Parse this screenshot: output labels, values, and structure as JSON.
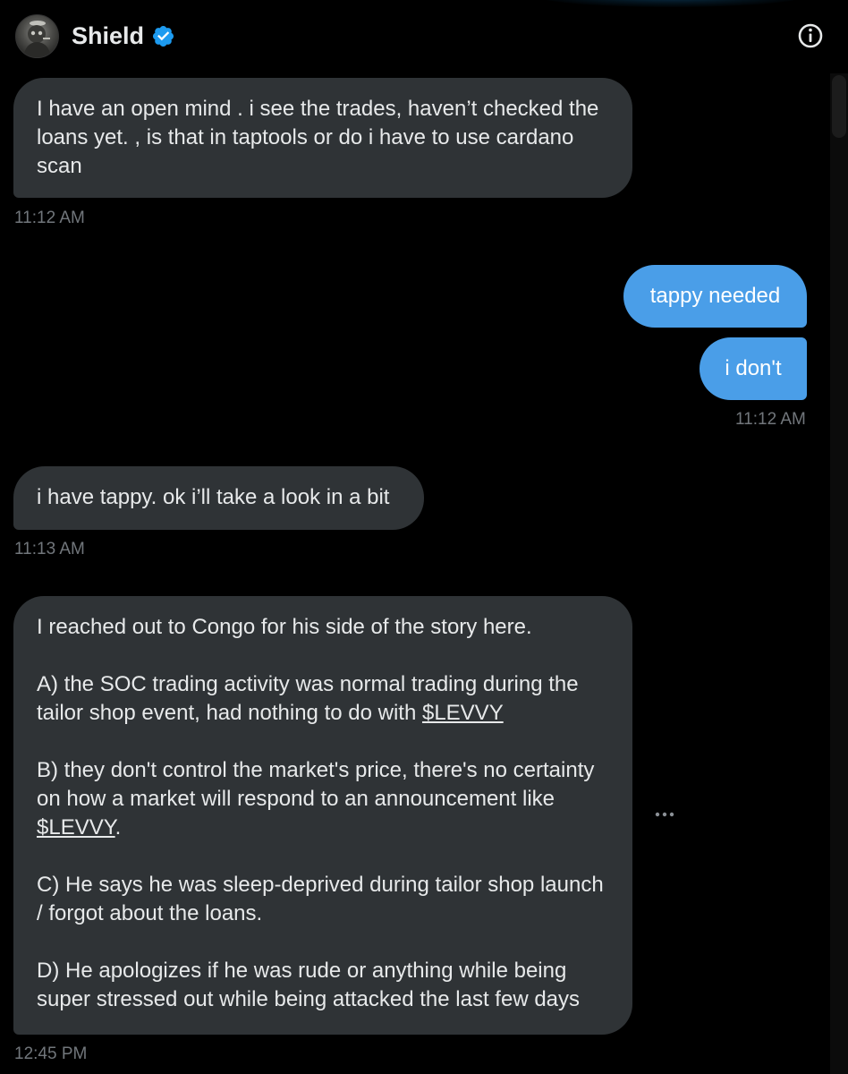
{
  "header": {
    "display_name": "Shield",
    "verified_icon": "verified-badge-icon",
    "info_icon": "info-icon"
  },
  "colors": {
    "background": "#000000",
    "incoming_bubble": "#2f3336",
    "outgoing_bubble": "#4a9ee8",
    "timestamp": "#71767b",
    "verified": "#1d9bf0"
  },
  "messages": [
    {
      "direction": "incoming",
      "text": "I have an open mind . i see the trades, haven’t checked the loans yet. , is that in taptools or do i have to use cardano scan",
      "time": "11:12 AM"
    },
    {
      "direction": "outgoing",
      "text": "tappy needed"
    },
    {
      "direction": "outgoing",
      "text": "i don't",
      "time": "11:12 AM"
    },
    {
      "direction": "incoming",
      "text": "i have tappy. ok i’ll take a look in a bit",
      "time": "11:13 AM"
    },
    {
      "direction": "incoming",
      "paragraphs": {
        "p1": "I reached out to Congo for his side of the story here.",
        "p2_text": "A) the SOC trading activity was normal trading during the tailor shop event, had nothing to do with ",
        "p2_tag": "$LEVVY",
        "p3_text": "B) they don't control the market's price, there's no certainty on how a market will respond to an announcement like ",
        "p3_tag": "$LEVVY",
        "p3_end": ".",
        "p4": "C) He says he was sleep-deprived during tailor shop launch / forgot about the loans.",
        "p5": "D) He apologizes if he was rude or anything while being super stressed out while being attacked the last few days"
      },
      "time": "12:45 PM",
      "more_icon": "more-horizontal-icon"
    }
  ]
}
